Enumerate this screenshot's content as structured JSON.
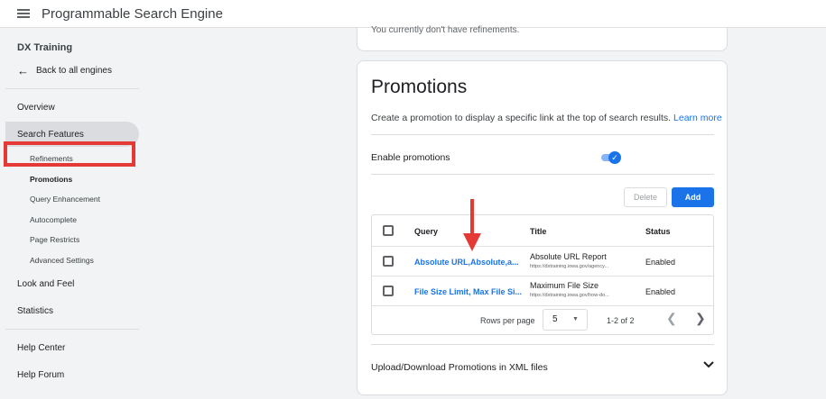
{
  "header": {
    "title": "Programmable Search Engine",
    "menu_icon": "menu-icon"
  },
  "sidebar": {
    "project_name": "DX Training",
    "back_label": "Back to all engines",
    "overview": "Overview",
    "search_features": "Search Features",
    "sub_items": [
      "Refinements",
      "Promotions",
      "Query Enhancement",
      "Autocomplete",
      "Page Restricts",
      "Advanced Settings"
    ],
    "selected_sub_item": "Promotions",
    "look_and_feel": "Look and Feel",
    "statistics": "Statistics",
    "help_center": "Help Center",
    "help_forum": "Help Forum"
  },
  "refinements_card": {
    "text": "You currently don't have refinements."
  },
  "promotions": {
    "title": "Promotions",
    "description": "Create a promotion to display a specific link at the top of search results.",
    "learn_more": "Learn more",
    "enable_label": "Enable promotions",
    "enabled": true,
    "delete_label": "Delete",
    "add_label": "Add",
    "table": {
      "headers": {
        "query": "Query",
        "title": "Title",
        "status": "Status"
      },
      "rows": [
        {
          "query": "Absolute URL,Absolute,a...",
          "title": "Absolute URL Report",
          "url": "https://dxtraining.iowa.gov/agency...",
          "status": "Enabled"
        },
        {
          "query": "File Size Limit, Max File Si...",
          "title": "Maximum File Size",
          "url": "https://dxtraining.iowa.gov/how-do...",
          "status": "Enabled"
        }
      ],
      "rows_per_page_label": "Rows per page",
      "rows_per_page": "5",
      "range": "1-2 of 2"
    },
    "upload_label": "Upload/Download Promotions in XML files"
  },
  "colors": {
    "accent": "#1a73e8",
    "highlight": "#e53935"
  }
}
